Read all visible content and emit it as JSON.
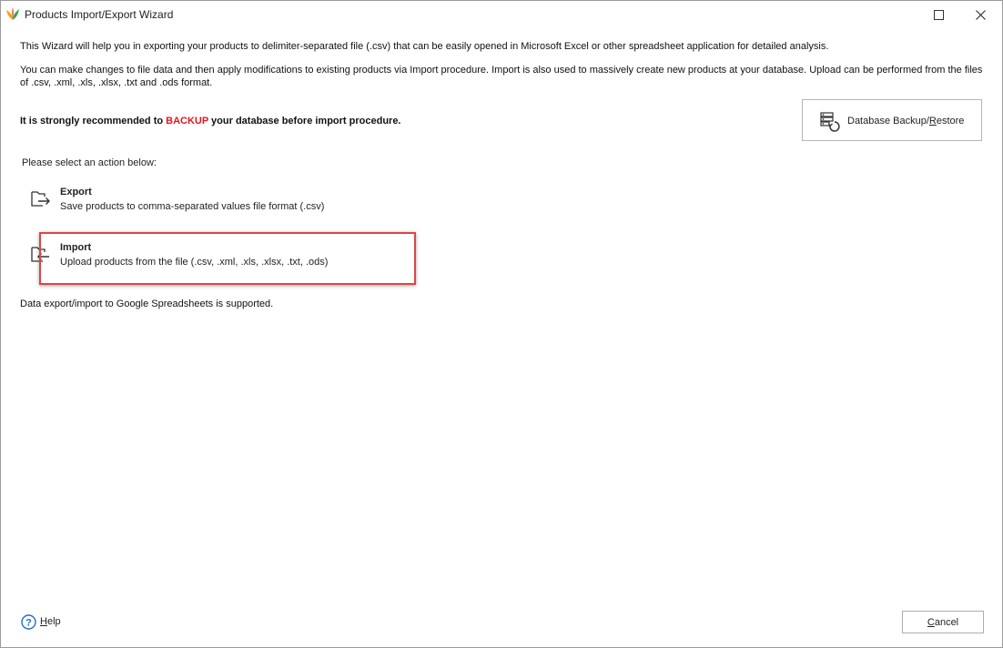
{
  "window": {
    "title": "Products Import/Export Wizard"
  },
  "intro": {
    "line1": "This Wizard will help you in exporting your products to delimiter-separated file (.csv) that can be easily opened in Microsoft Excel or other spreadsheet application for detailed analysis.",
    "line2": "You can make changes to file data and then apply modifications to existing products via Import procedure. Import is also used to massively create new products at your database. Upload can be performed from the files of .csv, .xml, .xls, .xlsx, .txt and .ods format.",
    "warning_prefix": "It is strongly recommended to ",
    "warning_highlight": "BACKUP",
    "warning_suffix": " your database before import procedure."
  },
  "backup_button": {
    "label_pre": "Database Backup/",
    "label_access": "R",
    "label_post": "estore",
    "icon": "database-restore-icon"
  },
  "select_label": "Please select an action below:",
  "actions": [
    {
      "title": "Export",
      "description": "Save products to comma-separated values file format (.csv)",
      "icon": "folder-export-icon"
    },
    {
      "title": "Import",
      "description": "Upload products from the file (.csv, .xml, .xls, .xlsx, .txt, .ods)",
      "icon": "folder-import-icon"
    }
  ],
  "note": "Data export/import to Google Spreadsheets is supported.",
  "footer": {
    "help_access": "H",
    "help_rest": "elp",
    "cancel_access": "C",
    "cancel_rest": "ancel"
  },
  "colors": {
    "warning_red": "#e8141c",
    "highlight_border": "#e04444"
  }
}
